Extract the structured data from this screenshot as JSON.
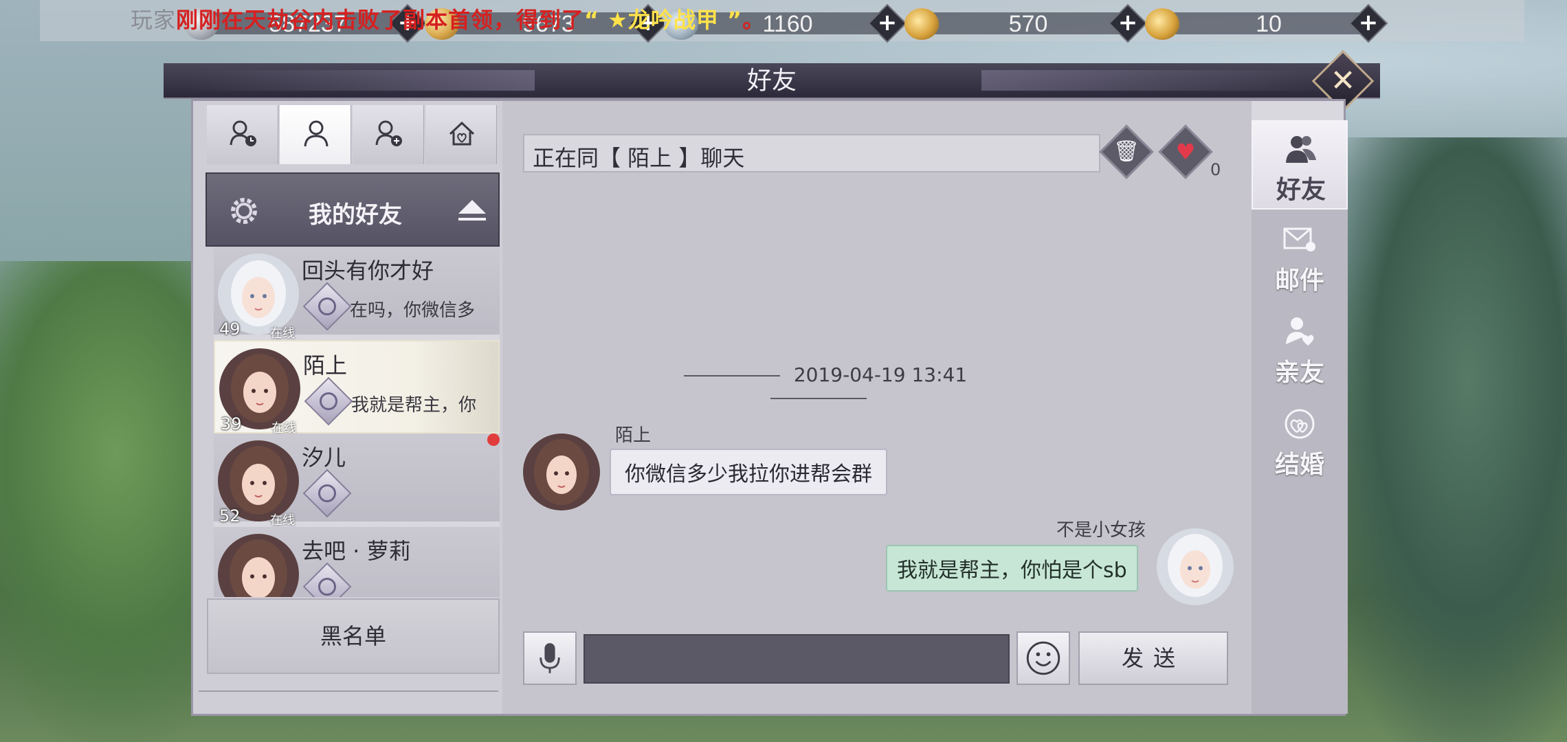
{
  "resources": [
    {
      "icon": "silver-coin-icon",
      "value": "587237"
    },
    {
      "icon": "gold-coin-icon",
      "value": "9673"
    },
    {
      "icon": "silver-ingot-icon",
      "value": "1160"
    },
    {
      "icon": "locked-gold-ingot-icon",
      "value": "570"
    },
    {
      "icon": "gold-ingot-icon",
      "value": "10"
    }
  ],
  "broadcast": {
    "prefix": "玩家",
    "text": "刚刚在天劫谷内击败了副本首领，得到了",
    "item": "“ ★龙吟战甲 ”",
    "suffix": "。"
  },
  "window": {
    "title": "好友",
    "close_label": "✕"
  },
  "left": {
    "tabs": [
      "recent-contacts-icon",
      "friends-icon",
      "add-friend-icon",
      "home-icon"
    ],
    "group_title": "我的好友",
    "friends": [
      {
        "name": "回头有你才好",
        "level": "49",
        "status": "在线",
        "last_message": "在吗，你微信多",
        "avatar": "white-hair"
      },
      {
        "name": "陌上",
        "level": "39",
        "status": "在线",
        "last_message": "我就是帮主，你",
        "avatar": "brown-hair"
      },
      {
        "name": "汐儿",
        "level": "52",
        "status": "在线",
        "last_message": "",
        "avatar": "brown-hair",
        "unread": true
      },
      {
        "name": "去吧 · 萝莉",
        "level": "",
        "status": "",
        "last_message": "",
        "avatar": "brown-hair"
      }
    ],
    "blacklist_label": "黑名单"
  },
  "chat": {
    "header": "正在同【 陌上 】聊天",
    "heart_count": "0",
    "timestamp": "2019-04-19 13:41",
    "messages": [
      {
        "direction": "in",
        "sender": "陌上",
        "text": "你微信多少我拉你进帮会群"
      },
      {
        "direction": "out",
        "sender": "不是小女孩",
        "text": "我就是帮主，你怕是个sb"
      }
    ],
    "input_value": "",
    "send_label": "发送"
  },
  "right_nav": [
    {
      "label": "好友",
      "icon": "friends-icon",
      "active": true
    },
    {
      "label": "邮件",
      "icon": "mail-icon",
      "active": false
    },
    {
      "label": "亲友",
      "icon": "relatives-icon",
      "active": false
    },
    {
      "label": "结婚",
      "icon": "marriage-icon",
      "active": false
    }
  ],
  "colors": {
    "accent": "#ffe24a",
    "broadcast": "#d62020",
    "bubble_out": "#c7e6d6",
    "bubble_in": "#ecebf2"
  }
}
